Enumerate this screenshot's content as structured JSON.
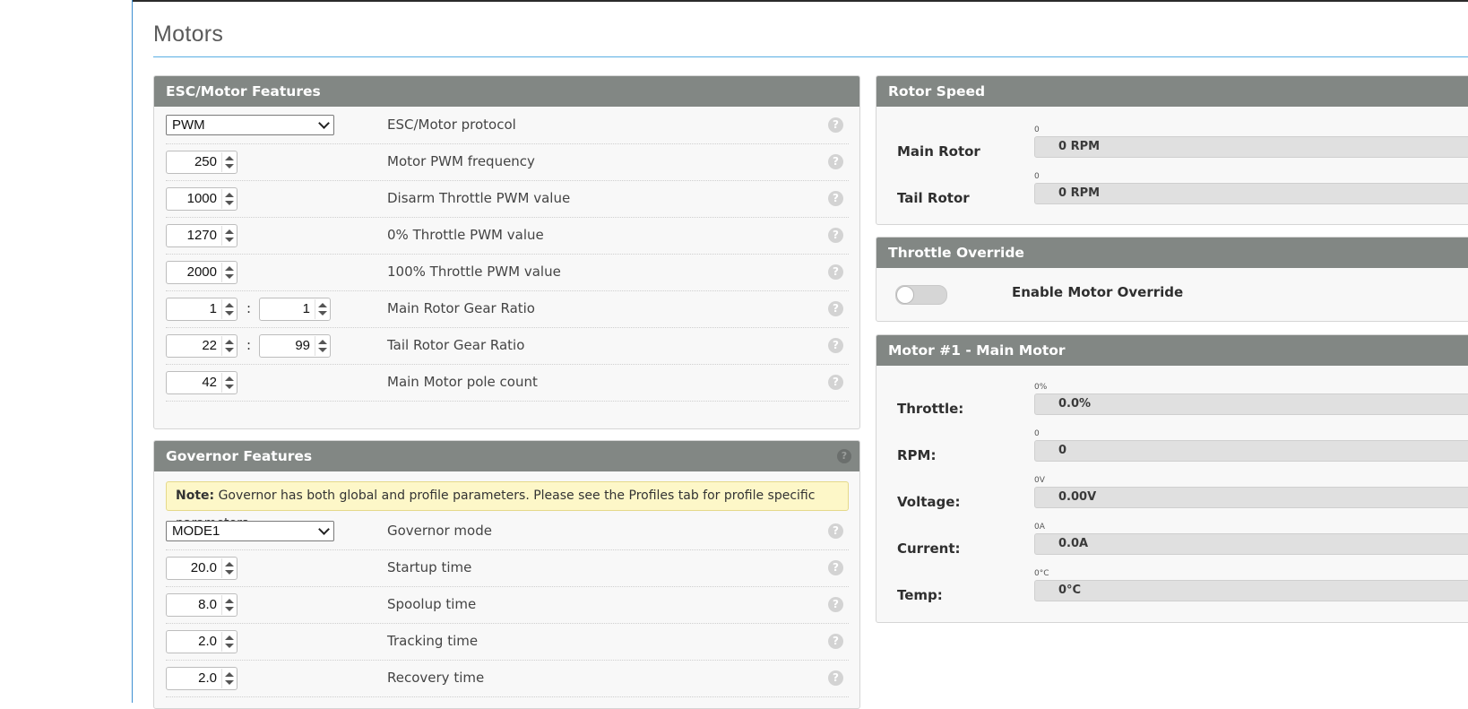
{
  "page": {
    "title": "Motors"
  },
  "esc_panel": {
    "header": "ESC/Motor Features",
    "rows": [
      {
        "kind": "select",
        "value": "PWM",
        "label": "ESC/Motor protocol"
      },
      {
        "kind": "number",
        "value": "250",
        "label": "Motor PWM frequency"
      },
      {
        "kind": "number",
        "value": "1000",
        "label": "Disarm Throttle PWM value"
      },
      {
        "kind": "number",
        "value": "1270",
        "label": "0% Throttle PWM value"
      },
      {
        "kind": "number",
        "value": "2000",
        "label": "100% Throttle PWM value"
      },
      {
        "kind": "ratio",
        "value": "1",
        "value2": "1",
        "separator": ":",
        "label": "Main Rotor Gear Ratio"
      },
      {
        "kind": "ratio",
        "value": "22",
        "value2": "99",
        "separator": ":",
        "label": "Tail Rotor Gear Ratio"
      },
      {
        "kind": "number",
        "value": "42",
        "label": "Main Motor pole count"
      }
    ]
  },
  "governor_panel": {
    "header": "Governor Features",
    "note_bold": "Note:",
    "note_text": " Governor has both global and profile parameters. Please see the Profiles tab for profile specific parameters.",
    "rows": [
      {
        "kind": "select",
        "value": "MODE1",
        "label": "Governor mode"
      },
      {
        "kind": "number",
        "value": "20.0",
        "label": "Startup time"
      },
      {
        "kind": "number",
        "value": "8.0",
        "label": "Spoolup time"
      },
      {
        "kind": "number",
        "value": "2.0",
        "label": "Tracking time"
      },
      {
        "kind": "number",
        "value": "2.0",
        "label": "Recovery time"
      }
    ]
  },
  "rotor_speed": {
    "header": "Rotor Speed",
    "rows": [
      {
        "label": "Main Rotor",
        "min": "0",
        "value": "0 RPM"
      },
      {
        "label": "Tail Rotor",
        "min": "0",
        "value": "0 RPM"
      }
    ]
  },
  "throttle_override": {
    "header": "Throttle Override",
    "toggle_label": "Enable Motor Override",
    "enabled": false
  },
  "motor1": {
    "header": "Motor #1 - Main Motor",
    "rows": [
      {
        "label": "Throttle:",
        "min": "0%",
        "value": "0.0%"
      },
      {
        "label": "RPM:",
        "min": "0",
        "value": "0"
      },
      {
        "label": "Voltage:",
        "min": "0V",
        "value": "0.00V"
      },
      {
        "label": "Current:",
        "min": "0A",
        "value": "0.0A"
      },
      {
        "label": "Temp:",
        "min": "0°C",
        "value": "0°C"
      }
    ]
  },
  "icons": {
    "help": "help-icon",
    "dropdown": "chevron-down-icon",
    "spinner": "spinner-arrows-icon"
  },
  "help_glyph": "?"
}
